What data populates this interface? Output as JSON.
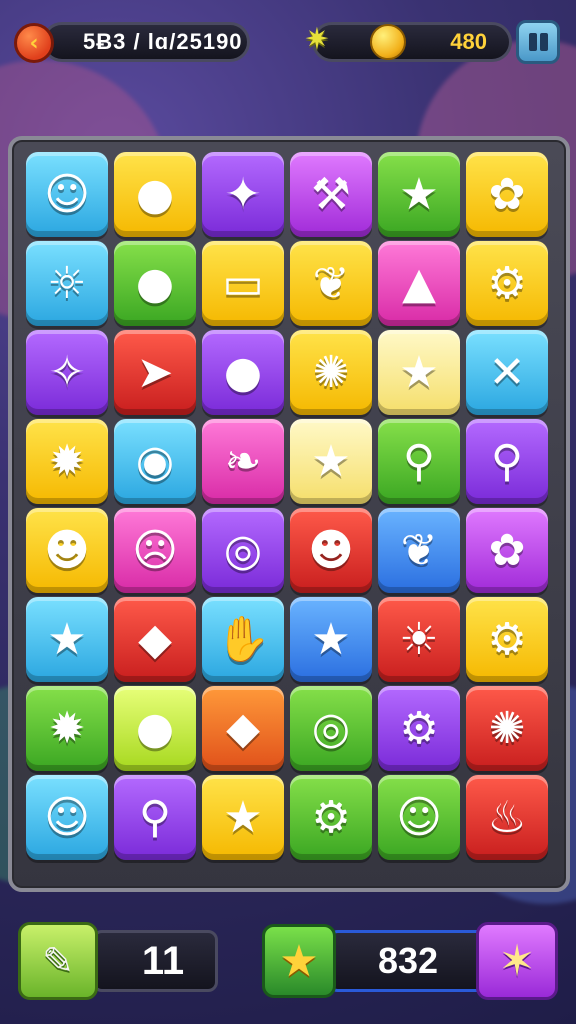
{
  "header": {
    "score_label": "5Ƀ3 / lɑ/25190",
    "coins": "480",
    "back_icon": "chevron-left-icon",
    "menu_icon": "pause-icon"
  },
  "colors": {
    "background": "#2a2658",
    "board_border": "#8a8a96",
    "coin": "#ffd23a"
  },
  "board": {
    "rows": 8,
    "cols": 6,
    "tiles": [
      {
        "color": "c-cyan",
        "icon": "smiley-face-icon",
        "glyph": "☺"
      },
      {
        "color": "c-yellow",
        "icon": "red-balloon-icon",
        "glyph": "●"
      },
      {
        "color": "c-purple",
        "icon": "blue-star-icon",
        "glyph": "✦"
      },
      {
        "color": "c-magenta",
        "icon": "hammer-icon",
        "glyph": "⚒"
      },
      {
        "color": "c-green",
        "icon": "yellow-star-icon",
        "glyph": "★"
      },
      {
        "color": "c-yellow",
        "icon": "red-fish-icon",
        "glyph": "✿"
      },
      {
        "color": "c-cyan",
        "icon": "sun-face-icon",
        "glyph": "☼"
      },
      {
        "color": "c-green",
        "icon": "green-blob-icon",
        "glyph": "●"
      },
      {
        "color": "c-yellow",
        "icon": "phone-card-icon",
        "glyph": "▭"
      },
      {
        "color": "c-yellow",
        "icon": "leaf-icon",
        "glyph": "❦"
      },
      {
        "color": "c-pink",
        "icon": "triangle-icon",
        "glyph": "▲"
      },
      {
        "color": "c-yellow",
        "icon": "gear-icon",
        "glyph": "⚙"
      },
      {
        "color": "c-purple",
        "icon": "fairy-wand-icon",
        "glyph": "✧"
      },
      {
        "color": "c-red",
        "icon": "green-arrow-icon",
        "glyph": "➤"
      },
      {
        "color": "c-purple",
        "icon": "lemon-icon",
        "glyph": "●"
      },
      {
        "color": "c-yellow",
        "icon": "sun-gear-icon",
        "glyph": "✺"
      },
      {
        "color": "c-cream",
        "icon": "blue-star-icon",
        "glyph": "★"
      },
      {
        "color": "c-cyan",
        "icon": "crossed-bones-icon",
        "glyph": "✕"
      },
      {
        "color": "c-yellow",
        "icon": "starburst-icon",
        "glyph": "✹"
      },
      {
        "color": "c-cyan",
        "icon": "spinning-top-icon",
        "glyph": "◉"
      },
      {
        "color": "c-pink",
        "icon": "chili-pepper-icon",
        "glyph": "❧"
      },
      {
        "color": "c-cream",
        "icon": "orange-star-icon",
        "glyph": "★"
      },
      {
        "color": "c-green",
        "icon": "yellow-key-icon",
        "glyph": "⚲"
      },
      {
        "color": "c-purple",
        "icon": "candy-stick-icon",
        "glyph": "⚲"
      },
      {
        "color": "c-yellow",
        "icon": "green-monster-icon",
        "glyph": "☻"
      },
      {
        "color": "c-pink",
        "icon": "red-face-icon",
        "glyph": "☹"
      },
      {
        "color": "c-purple",
        "icon": "ring-icon",
        "glyph": "◎"
      },
      {
        "color": "c-red",
        "icon": "grey-face-icon",
        "glyph": "☻"
      },
      {
        "color": "c-blue",
        "icon": "feather-icon",
        "glyph": "❦"
      },
      {
        "color": "c-magenta",
        "icon": "white-flower-icon",
        "glyph": "✿"
      },
      {
        "color": "c-cyan",
        "icon": "yellow-star-icon",
        "glyph": "★"
      },
      {
        "color": "c-red",
        "icon": "gold-diamond-icon",
        "glyph": "◆"
      },
      {
        "color": "c-cyan",
        "icon": "lollipop-icon",
        "glyph": "✋"
      },
      {
        "color": "c-blue",
        "icon": "pink-star-icon",
        "glyph": "★"
      },
      {
        "color": "c-red",
        "icon": "sun-wand-icon",
        "glyph": "☀"
      },
      {
        "color": "c-yellow",
        "icon": "blue-gear-icon",
        "glyph": "⚙"
      },
      {
        "color": "c-green",
        "icon": "yellow-gear-icon",
        "glyph": "✹"
      },
      {
        "color": "c-lime",
        "icon": "green-egg-icon",
        "glyph": "●"
      },
      {
        "color": "c-orange",
        "icon": "blue-diamond-icon",
        "glyph": "◆"
      },
      {
        "color": "c-green",
        "icon": "spiral-icon",
        "glyph": "◎"
      },
      {
        "color": "c-purple",
        "icon": "blue-gear-icon",
        "glyph": "⚙"
      },
      {
        "color": "c-red",
        "icon": "blue-gem-icon",
        "glyph": "✺"
      },
      {
        "color": "c-cyan",
        "icon": "brown-face-icon",
        "glyph": "☺"
      },
      {
        "color": "c-purple",
        "icon": "candy-wand-icon",
        "glyph": "⚲"
      },
      {
        "color": "c-yellow",
        "icon": "yellow-star-icon",
        "glyph": "★"
      },
      {
        "color": "c-green",
        "icon": "blue-cog-icon",
        "glyph": "⚙"
      },
      {
        "color": "c-green",
        "icon": "orange-face-icon",
        "glyph": "☺"
      },
      {
        "color": "c-red",
        "icon": "rocket-icon",
        "glyph": "♨"
      }
    ]
  },
  "footer": {
    "moves": "11",
    "total": "832",
    "tool_icon": "eraser-icon",
    "star_icon": "star-icon",
    "boost_icon": "sparkle-star-icon"
  }
}
